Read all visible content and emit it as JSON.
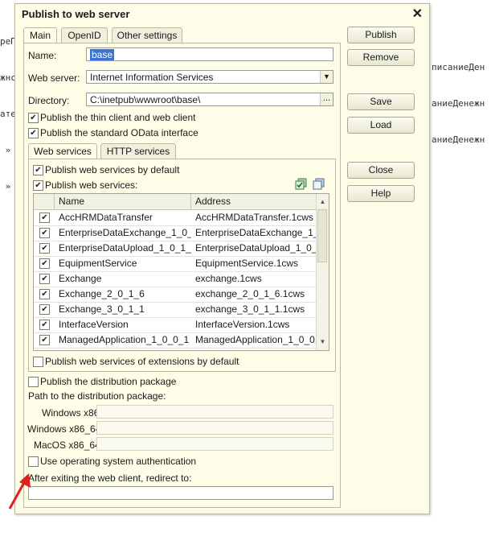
{
  "background": {
    "left_lines": [
      "рeП",
      "жнс",
      "ате",
      " »",
      " »"
    ],
    "right_lines": [
      "писаниеДен",
      "аниеДенежн",
      "аниеДенежн"
    ]
  },
  "dialog": {
    "title": "Publish to web server",
    "tabs": [
      "Main",
      "OpenID",
      "Other settings"
    ],
    "name_label": "Name:",
    "name_value": "base",
    "webserver_label": "Web server:",
    "webserver_value": "Internet Information Services",
    "directory_label": "Directory:",
    "directory_value": "C:\\inetpub\\wwwroot\\base\\",
    "browse_label": "...",
    "publish_thin_label": "Publish the thin client and web client",
    "publish_odata_label": "Publish the standard OData interface",
    "inner_tabs": [
      "Web services",
      "HTTP services"
    ],
    "ws_default_label": "Publish web services by default",
    "ws_publish_label": "Publish web services:",
    "columns": [
      "Name",
      "Address"
    ],
    "rows": [
      {
        "name": "AccHRMDataTransfer",
        "address": "AccHRMDataTransfer.1cws"
      },
      {
        "name": "EnterpriseDataExchange_1_0_...",
        "address": "EnterpriseDataExchange_1_..."
      },
      {
        "name": "EnterpriseDataUpload_1_0_1_1",
        "address": "EnterpriseDataUpload_1_0_..."
      },
      {
        "name": "EquipmentService",
        "address": "EquipmentService.1cws"
      },
      {
        "name": "Exchange",
        "address": "exchange.1cws"
      },
      {
        "name": "Exchange_2_0_1_6",
        "address": "exchange_2_0_1_6.1cws"
      },
      {
        "name": "Exchange_3_0_1_1",
        "address": "exchange_3_0_1_1.1cws"
      },
      {
        "name": "InterfaceVersion",
        "address": "InterfaceVersion.1cws"
      },
      {
        "name": "ManagedApplication_1_0_0_1",
        "address": "ManagedApplication_1_0_0..."
      }
    ],
    "ext_default_label": "Publish web services of extensions by default",
    "distribution_label": "Publish the distribution package",
    "path_label": "Path to the distribution package:",
    "win86_label": "Windows x86:",
    "win64_label": "Windows x86_64:",
    "mac_label": "MacOS x86_64:",
    "os_auth_label": "Use operating system authentication",
    "redirect_label": "After exiting the web client, redirect to:",
    "buttons": {
      "publish": "Publish",
      "remove": "Remove",
      "save": "Save",
      "load": "Load",
      "close": "Close",
      "help": "Help"
    }
  },
  "colors": {
    "accent_arrow": "#e02020",
    "selection": "#3875d7"
  }
}
